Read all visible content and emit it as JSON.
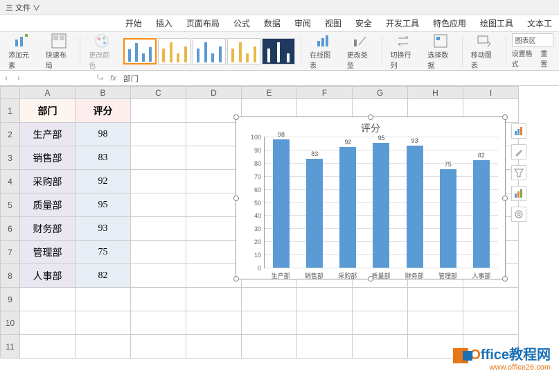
{
  "title_bar": {
    "file_menu": "三 文件 ∨"
  },
  "menu": {
    "items": [
      "开始",
      "插入",
      "页面布局",
      "公式",
      "数据",
      "审阅",
      "视图",
      "安全",
      "开发工具",
      "特色应用",
      "绘图工具",
      "文本工"
    ]
  },
  "ribbon": {
    "add_element": "添加元素",
    "quick_layout": "快速布局",
    "change_color": "更改颜色",
    "online_chart": "在线图表",
    "change_type": "更改类型",
    "switch_rc": "切换行列",
    "select_data": "选择数据",
    "move_chart": "移动图表",
    "chart_area": "图表区",
    "set_format": "设置格式",
    "reset": "重置"
  },
  "formula": {
    "fx": "fx",
    "content": "部门"
  },
  "columns": [
    "A",
    "B",
    "C",
    "D",
    "E",
    "F",
    "G",
    "H",
    "I"
  ],
  "rows": [
    "1",
    "2",
    "3",
    "4",
    "5",
    "6",
    "7",
    "8",
    "9",
    "10",
    "11"
  ],
  "table": {
    "h1": "部门",
    "h2": "评分",
    "r": [
      {
        "a": "生产部",
        "b": "98"
      },
      {
        "a": "销售部",
        "b": "83"
      },
      {
        "a": "采购部",
        "b": "92"
      },
      {
        "a": "质量部",
        "b": "95"
      },
      {
        "a": "财务部",
        "b": "93"
      },
      {
        "a": "管理部",
        "b": "75"
      },
      {
        "a": "人事部",
        "b": "82"
      }
    ]
  },
  "chart_data": {
    "type": "bar",
    "title": "评分",
    "categories": [
      "生产部",
      "销售部",
      "采购部",
      "质量部",
      "财务部",
      "管理部",
      "人事部"
    ],
    "values": [
      98,
      83,
      92,
      95,
      93,
      75,
      82
    ],
    "ylim": [
      0,
      100
    ],
    "yticks": [
      0,
      10,
      20,
      30,
      40,
      50,
      60,
      70,
      80,
      90,
      100
    ],
    "xlabel": "",
    "ylabel": ""
  },
  "watermark": {
    "brand_o": "O",
    "brand_rest": "ffice教程网",
    "url": "www.office26.com"
  }
}
